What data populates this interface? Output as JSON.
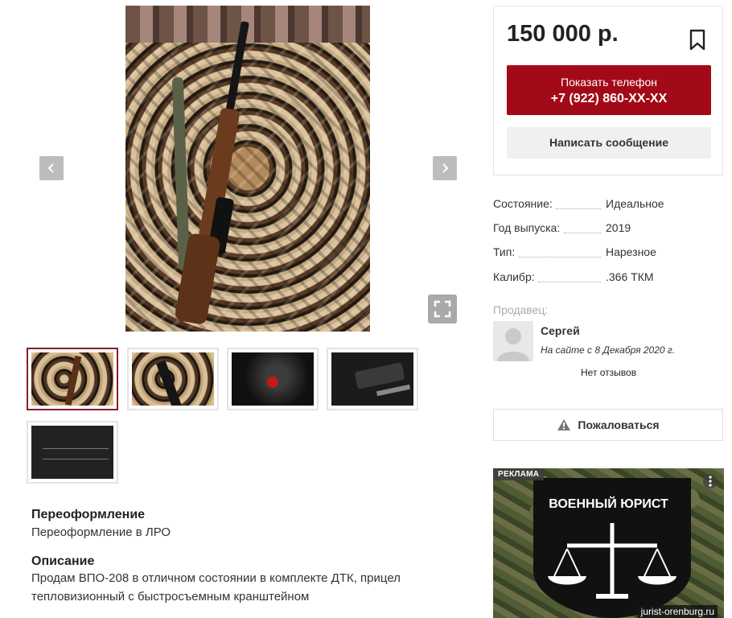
{
  "gallery": {
    "thumbnails": [
      "photo-1",
      "photo-2",
      "photo-3",
      "photo-4",
      "photo-5"
    ]
  },
  "details": {
    "reregistration_title": "Переоформление",
    "reregistration_text": "Переоформление в ЛРО",
    "description_title": "Описание",
    "description_text": "Продам ВПО-208 в отличном состоянии в комплекте ДТК, прицел тепловизионный с быстросъемным кранштейном"
  },
  "offer": {
    "price": "150 000 р.",
    "show_phone_label": "Показать телефон",
    "phone_masked": "+7 (922) 860-XX-XX",
    "message_label": "Написать сообщение",
    "accent_color": "#a30a17"
  },
  "properties": [
    {
      "key": "Состояние:",
      "value": "Идеальное"
    },
    {
      "key": "Год выпуска:",
      "value": "2019"
    },
    {
      "key": "Тип:",
      "value": "Нарезное"
    },
    {
      "key": "Калибр:",
      "value": ".366 ТКМ"
    }
  ],
  "seller": {
    "label": "Продавец:",
    "name": "Сергей",
    "since": "На сайте с 8 Декабря 2020 г.",
    "reviews": "Нет отзывов"
  },
  "report": {
    "label": "Пожаловаться"
  },
  "ad": {
    "badge": "РЕКЛАМА",
    "title": "ВОЕННЫЙ ЮРИСТ",
    "domain": "jurist-orenburg.ru"
  }
}
